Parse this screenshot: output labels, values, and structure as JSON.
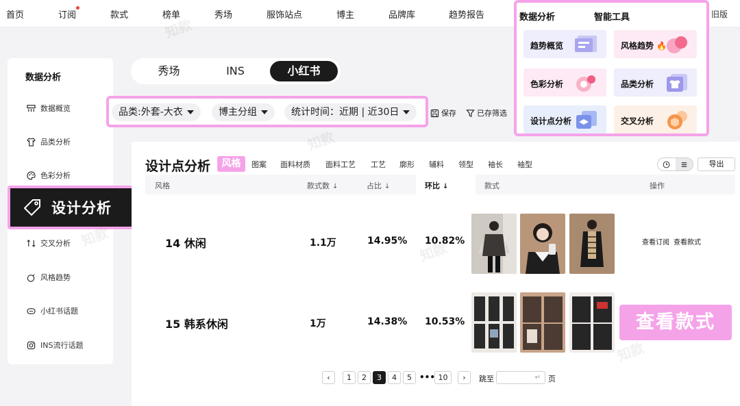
{
  "topnav": {
    "items": [
      "首页",
      "订阅",
      "款式",
      "榜单",
      "秀场",
      "服饰站点",
      "博主",
      "品牌库",
      "趋势报告"
    ],
    "old_version": "旧版"
  },
  "popup": {
    "heading_left": "数据分析",
    "heading_right": "智能工具",
    "tiles": [
      {
        "label": "趋势概览",
        "bg": "#eeeefc"
      },
      {
        "label": "风格趋势",
        "bg": "#fdeaf4"
      },
      {
        "label": "色彩分析",
        "bg": "#fdeaf4"
      },
      {
        "label": "品类分析",
        "bg": "#eeeefc"
      },
      {
        "label": "设计点分析",
        "bg": "#e9eefc"
      },
      {
        "label": "交叉分析",
        "bg": "#fdf0e6"
      }
    ]
  },
  "sidebar": {
    "title": "数据分析",
    "items": [
      "数据概览",
      "品类分析",
      "色彩分析",
      "设计分析",
      "交叉分析",
      "风格趋势",
      "小红书话题",
      "INS流行话题"
    ],
    "active_index": 3
  },
  "platform_tabs": {
    "items": [
      "秀场",
      "INS",
      "小红书"
    ],
    "active_index": 2
  },
  "filters": {
    "category": "品类:外套-大衣",
    "blogger_group": "博主分组",
    "time": "统计时间：近期 | 近30日",
    "save": "保存",
    "saved_filters": "已存筛选"
  },
  "card": {
    "title": "设计点分析",
    "active_dimension": "风格",
    "dimensions": [
      "图案",
      "面料材质",
      "面料工艺",
      "工艺",
      "廓形",
      "辅料",
      "领型",
      "袖长",
      "袖型"
    ],
    "export": "导出",
    "columns": {
      "style": "风格",
      "count": "款式数",
      "share": "占比",
      "mom": "环比",
      "styles": "款式",
      "ops": "操作"
    },
    "rows": [
      {
        "name": "14 休闲",
        "count": "1.1万",
        "share": "14.95%",
        "mom": "10.82%",
        "op_subscribe": "查看订阅",
        "op_styles": "查看款式"
      },
      {
        "name": "15 韩系休闲",
        "count": "1万",
        "share": "14.38%",
        "mom": "10.53%"
      }
    ]
  },
  "pagination": {
    "pages": [
      "1",
      "2",
      "3",
      "4",
      "5",
      "10"
    ],
    "current": "3",
    "jump_label": "跳至",
    "page_suffix": "页",
    "input_hint": "↵"
  },
  "cta": "查看款式",
  "watermark": "知款"
}
